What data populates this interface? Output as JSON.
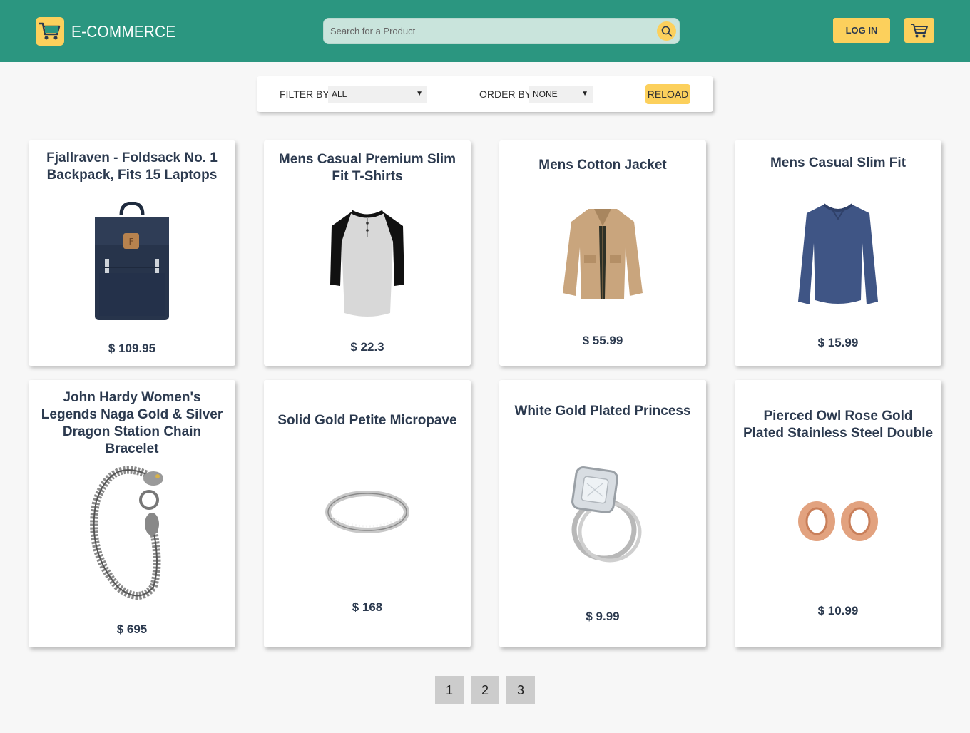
{
  "header": {
    "brand_name": "E-COMMERCE",
    "search_placeholder": "Search for a Product",
    "login_label": "LOG IN",
    "accent_color": "#2b9680",
    "button_color": "#fcd05c"
  },
  "filters": {
    "filter_label": "FILTER BY",
    "filter_value": "ALL",
    "order_label": "ORDER BY",
    "order_value": "NONE",
    "reload_label": "RELOAD"
  },
  "products": [
    {
      "title": "Fjallraven - Foldsack No. 1 Backpack, Fits 15 Laptops",
      "price": "$ 109.95",
      "image": "backpack-image"
    },
    {
      "title": "Mens Casual Premium Slim Fit T-Shirts",
      "price": "$ 22.3",
      "image": "tshirt-image"
    },
    {
      "title": "Mens Cotton Jacket",
      "price": "$ 55.99",
      "image": "jacket-image"
    },
    {
      "title": "Mens Casual Slim Fit",
      "price": "$ 15.99",
      "image": "longsleeve-image"
    },
    {
      "title": "John Hardy Women's Legends Naga Gold & Silver Dragon Station Chain Bracelet",
      "price": "$ 695",
      "image": "bracelet-image"
    },
    {
      "title": "Solid Gold Petite Micropave",
      "price": "$ 168",
      "image": "ring-image"
    },
    {
      "title": "White Gold Plated Princess",
      "price": "$ 9.99",
      "image": "princess-ring-image"
    },
    {
      "title": "Pierced Owl Rose Gold Plated Stainless Steel Double",
      "price": "$ 10.99",
      "image": "earrings-image"
    }
  ],
  "pagination": [
    "1",
    "2",
    "3"
  ]
}
